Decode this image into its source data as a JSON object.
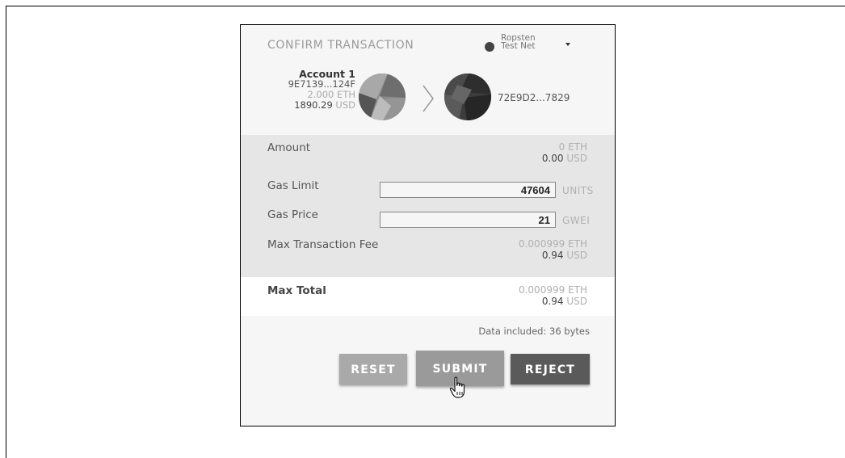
{
  "header": {
    "title": "CONFIRM TRANSACTION",
    "network_line1": "Ropsten",
    "network_line2": "Test Net",
    "network_icon": "circle-dot-icon",
    "dropdown_icon": "caret-down-icon"
  },
  "from_account": {
    "name": "Account 1",
    "address": "9E7139...124F",
    "balance_eth": "2.000",
    "eth_unit": "ETH",
    "balance_usd": "1890.29",
    "usd_unit": "USD"
  },
  "to_account": {
    "address": "72E9D2...7829"
  },
  "amount": {
    "label": "Amount",
    "eth_value": "0",
    "eth_unit": "ETH",
    "usd_value": "0.00",
    "usd_unit": "USD"
  },
  "gas_limit": {
    "label": "Gas Limit",
    "value": "47604",
    "unit": "UNITS"
  },
  "gas_price": {
    "label": "Gas Price",
    "value": "21",
    "unit": "GWEI"
  },
  "max_fee": {
    "label": "Max Transaction Fee",
    "eth_value": "0.000999",
    "eth_unit": "ETH",
    "usd_value": "0.94",
    "usd_unit": "USD"
  },
  "max_total": {
    "label": "Max Total",
    "eth_value": "0.000999",
    "eth_unit": "ETH",
    "usd_value": "0.94",
    "usd_unit": "USD"
  },
  "data_included": "Data included: 36 bytes",
  "buttons": {
    "reset": "RESET",
    "submit": "SUBMIT",
    "reject": "REJECT"
  },
  "colors": {
    "popup_bg": "#f6f6f6",
    "details_bg": "#e6e6e6",
    "reset_bg": "#a9a9a9",
    "submit_bg": "#9a9a9a",
    "reject_bg": "#5a5a5a"
  }
}
